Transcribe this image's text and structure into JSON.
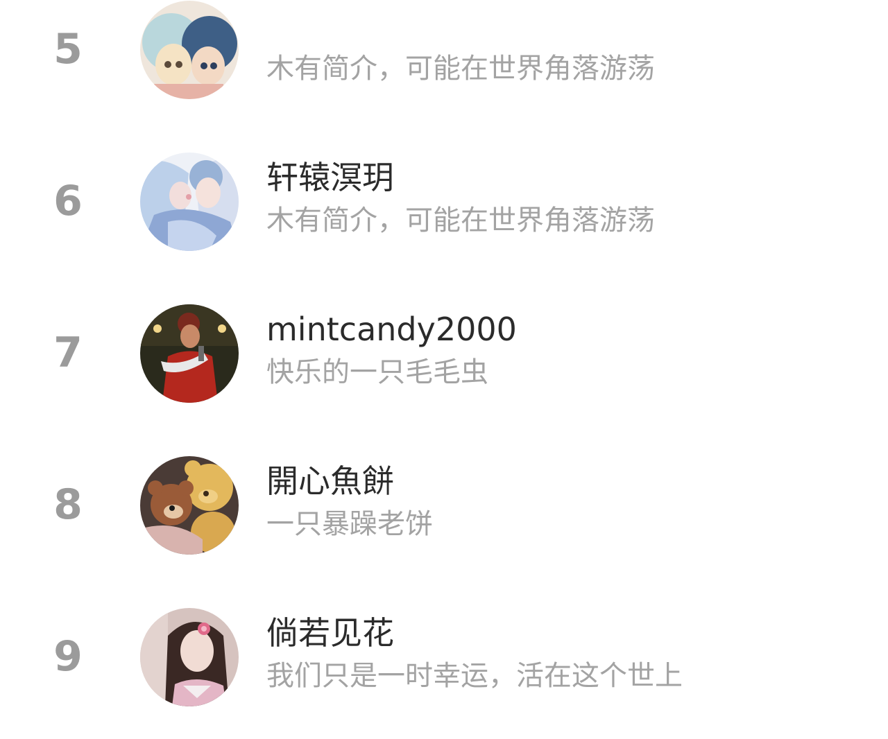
{
  "ranking": {
    "items": [
      {
        "rank": "5",
        "name": "",
        "bio": "木有简介，可能在世界角落游荡",
        "avatar": "anime-duo-avatar"
      },
      {
        "rank": "6",
        "name": "轩辕溟玥",
        "bio": "木有简介，可能在世界角落游荡",
        "avatar": "anime-couple-avatar"
      },
      {
        "rank": "7",
        "name": "mintcandy2000",
        "bio": "快乐的一只毛毛虫",
        "avatar": "woman-red-dress-avatar"
      },
      {
        "rank": "8",
        "name": "開心魚餅",
        "bio": "一只暴躁老饼",
        "avatar": "teddy-bears-avatar"
      },
      {
        "rank": "9",
        "name": "倘若见花",
        "bio": "我们只是一时幸运，活在这个世上",
        "avatar": "girl-portrait-avatar"
      }
    ]
  },
  "colors": {
    "rank": "#9b9b9b",
    "name": "#2b2b2b",
    "bio": "#a3a3a3",
    "background": "#ffffff"
  }
}
